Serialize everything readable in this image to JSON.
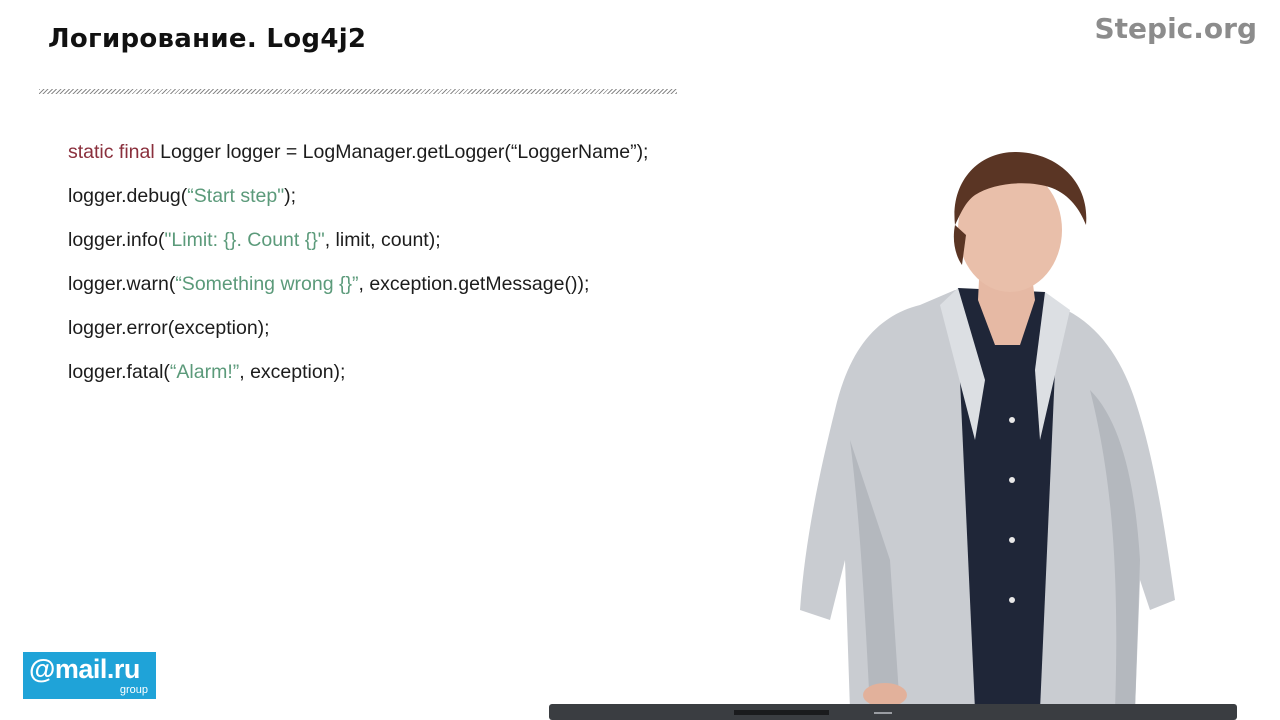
{
  "slide": {
    "title": "Логирование. Log4j2",
    "brand": "Stepic.org"
  },
  "code": {
    "line1": {
      "keyword": "static final",
      "rest": " Logger logger = LogManager.getLogger(“LoggerName”);"
    },
    "line2": {
      "pre": "logger.debug(",
      "str": "“Start step\"",
      "post": ");"
    },
    "line3": {
      "pre": "logger.info(",
      "str": "\"Limit: {}. Count {}\"",
      "post": ", limit, count);"
    },
    "line4": {
      "pre": "logger.warn(",
      "str": "“Something wrong {}”",
      "post": ", exception.getMessage());"
    },
    "line5": {
      "text": "logger.error(exception);"
    },
    "line6": {
      "pre": "logger.fatal(",
      "str": "“Alarm!”",
      "post": ", exception);"
    }
  },
  "logo": {
    "main": "@mail.ru",
    "sub": "group"
  },
  "colors": {
    "keyword": "#8a2f3c",
    "string": "#5b9a7a",
    "logo_bg": "#1fa3d8",
    "brand": "#8c8c8c"
  },
  "icons": {
    "presenter": "presenter-figure",
    "laptop": "laptop-icon"
  }
}
